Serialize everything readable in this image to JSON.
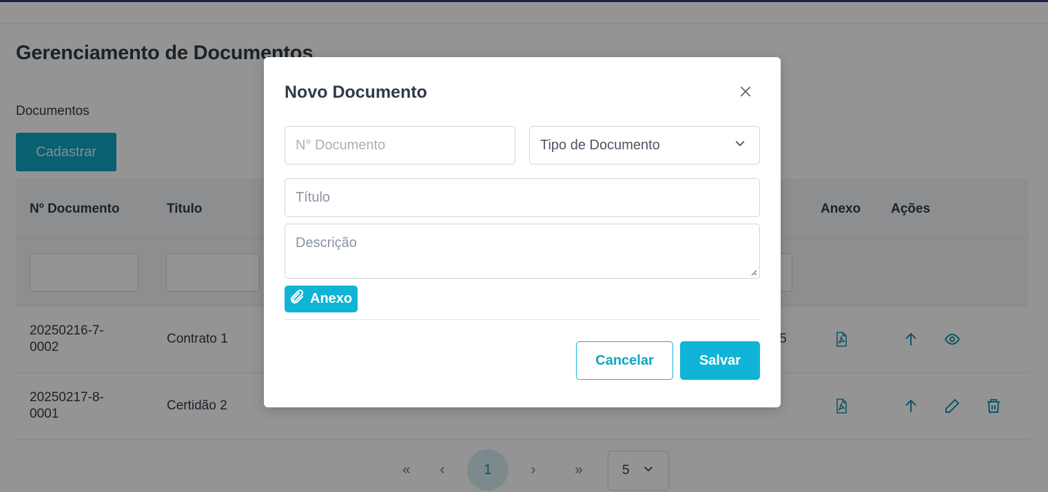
{
  "page": {
    "title": "Gerenciamento de Documentos",
    "section_label": "Documentos",
    "register_button": "Cadastrar"
  },
  "table": {
    "headers": {
      "number": "Nº Documento",
      "title": "Titulo",
      "attachment": "Anexo",
      "actions": "Ações"
    },
    "rows": [
      {
        "number": "20250216-7-0002",
        "title": "Contrato 1",
        "extra": "5",
        "actions": [
          "pdf-icon",
          "arrow-up-icon",
          "eye-icon"
        ]
      },
      {
        "number": "20250217-8-0001",
        "title": "Certidão 2",
        "extra": "",
        "actions": [
          "pdf-icon",
          "arrow-up-icon",
          "pencil-icon",
          "trash-icon"
        ]
      }
    ]
  },
  "pagination": {
    "first": "«",
    "prev": "‹",
    "current_page": "1",
    "next": "›",
    "last": "»",
    "page_size": "5"
  },
  "modal": {
    "title": "Novo Documento",
    "number_placeholder": "N° Documento",
    "type_placeholder": "Tipo de Documento",
    "title_placeholder": "Título",
    "description_placeholder": "Descrição",
    "attach_button": "Anexo",
    "cancel_button": "Cancelar",
    "save_button": "Salvar"
  },
  "colors": {
    "accent": "#10b4d6",
    "icon": "#1893b0",
    "topbar": "#2d3a7a"
  }
}
